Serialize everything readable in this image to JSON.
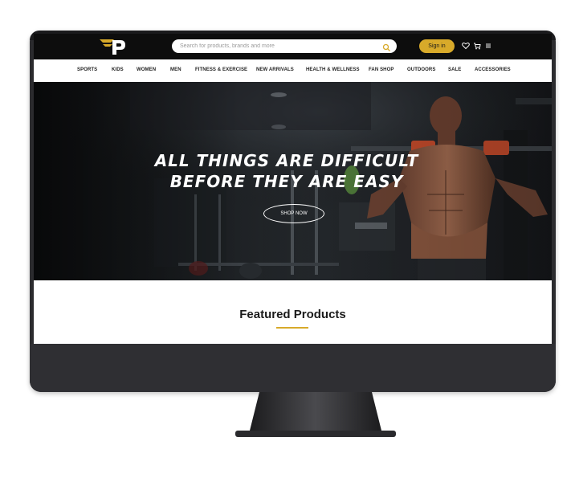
{
  "header": {
    "search_placeholder": "Search for products, brands and more",
    "signin_label": "Sign in"
  },
  "nav": {
    "items": [
      {
        "label": "SPORTS"
      },
      {
        "label": "KIDS"
      },
      {
        "label": "WOMEN"
      },
      {
        "label": "MEN"
      },
      {
        "label": "FITNESS & EXERCISE"
      },
      {
        "label": "NEW ARRIVALS"
      },
      {
        "label": "HEALTH & WELLNESS"
      },
      {
        "label": "FAN SHOP"
      },
      {
        "label": "OUTDOORS"
      },
      {
        "label": "SALE"
      },
      {
        "label": "ACCESSORIES"
      }
    ]
  },
  "hero": {
    "line1": "ALL THINGS ARE DIFFICULT",
    "line2": "BEFORE THEY ARE EASY",
    "cta": "SHOP NOW"
  },
  "featured": {
    "title": "Featured Products"
  },
  "colors": {
    "accent": "#d8aa2a",
    "header_bg": "#0d0d0d"
  },
  "icons": [
    "logo-icon",
    "search-icon",
    "heart-icon",
    "cart-icon",
    "menu-icon"
  ]
}
